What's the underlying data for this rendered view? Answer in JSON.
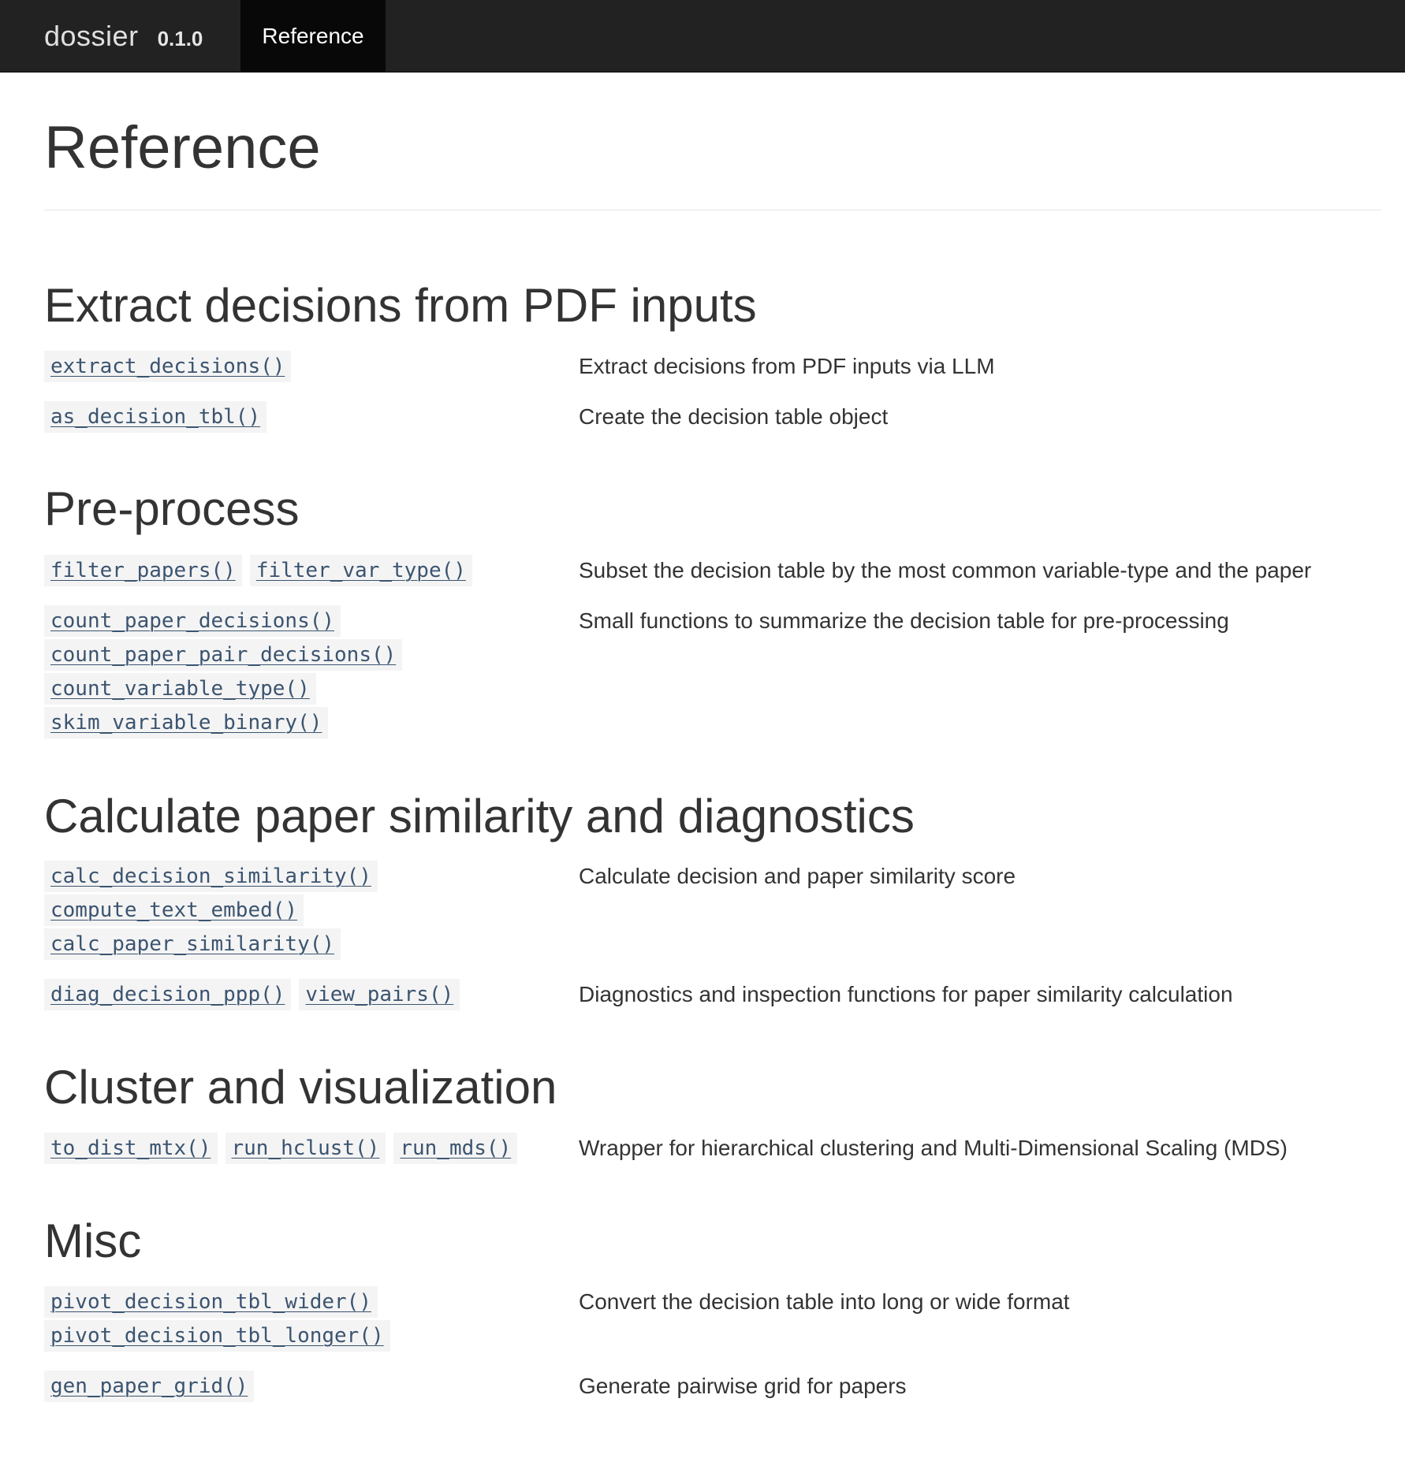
{
  "navbar": {
    "brand": "dossier",
    "version": "0.1.0",
    "tab_reference": "Reference"
  },
  "page": {
    "title": "Reference"
  },
  "sections": [
    {
      "heading": "Extract decisions from PDF inputs",
      "rows": [
        {
          "fns": [
            "extract_decisions()"
          ],
          "desc": "Extract decisions from PDF inputs via LLM"
        },
        {
          "fns": [
            "as_decision_tbl()"
          ],
          "desc": "Create the decision table object"
        }
      ]
    },
    {
      "heading": "Pre-process",
      "rows": [
        {
          "fns": [
            "filter_papers()",
            "filter_var_type()"
          ],
          "desc": "Subset the decision table by the most common variable-type and the paper"
        },
        {
          "fns": [
            "count_paper_decisions()",
            "count_paper_pair_decisions()",
            "count_variable_type()",
            "skim_variable_binary()"
          ],
          "desc": "Small functions to summarize the decision table for pre-processing"
        }
      ]
    },
    {
      "heading": "Calculate paper similarity and diagnostics",
      "rows": [
        {
          "fns": [
            "calc_decision_similarity()",
            "compute_text_embed()",
            "calc_paper_similarity()"
          ],
          "desc": "Calculate decision and paper similarity score"
        },
        {
          "fns": [
            "diag_decision_ppp()",
            "view_pairs()"
          ],
          "desc": "Diagnostics and inspection functions for paper similarity calculation"
        }
      ]
    },
    {
      "heading": "Cluster and visualization",
      "rows": [
        {
          "fns": [
            "to_dist_mtx()",
            "run_hclust()",
            "run_mds()"
          ],
          "desc": "Wrapper for hierarchical clustering and Multi-Dimensional Scaling (MDS)"
        }
      ]
    },
    {
      "heading": "Misc",
      "rows": [
        {
          "fns": [
            "pivot_decision_tbl_wider()",
            "pivot_decision_tbl_longer()"
          ],
          "desc": "Convert the decision table into long or wide format"
        },
        {
          "fns": [
            "gen_paper_grid()"
          ],
          "desc": "Generate pairwise grid for papers"
        }
      ]
    }
  ]
}
